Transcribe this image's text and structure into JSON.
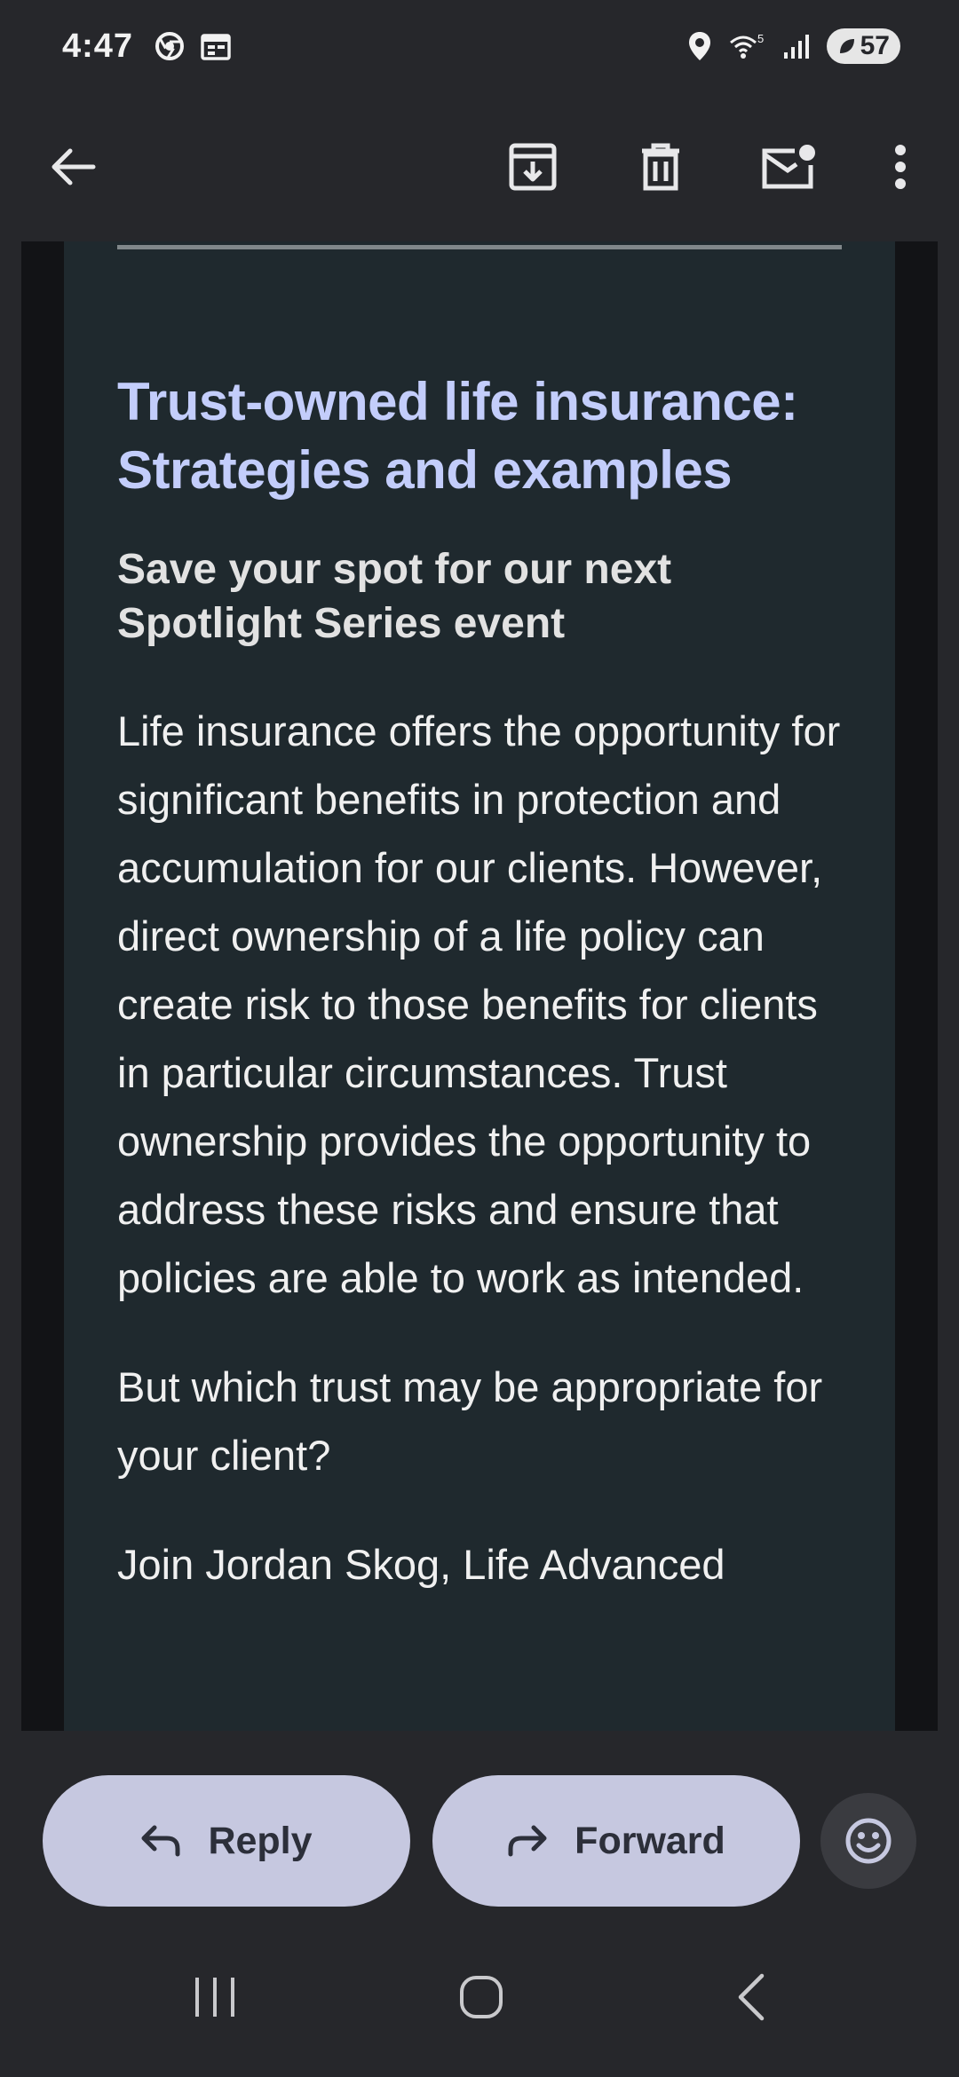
{
  "status_bar": {
    "time": "4:47",
    "battery": "57",
    "wifi_badge": "5"
  },
  "app_bar": {
    "icons": [
      "back-arrow-icon",
      "archive-icon",
      "delete-icon",
      "mark-unread-icon",
      "more-options-icon"
    ]
  },
  "email": {
    "headline": "Trust-owned life insurance: Strategies and examples",
    "subhead": "Save your spot for our next Spotlight Series event",
    "paragraphs": [
      "Life insurance offers the opportunity for significant benefits in protection and accumulation for our clients. However, direct ownership of a life policy can create risk to those benefits for clients in particular circumstances. Trust ownership provides the opportunity to address these risks and ensure that policies are able to work as intended.",
      "But which trust may be appropriate for your client?",
      "Join Jordan Skog, Life Advanced"
    ]
  },
  "actions": {
    "reply_label": "Reply",
    "forward_label": "Forward"
  },
  "colors": {
    "headline": "#c3cdfb",
    "card_bg": "#1f292e",
    "pill_bg": "#c6c8e0"
  }
}
